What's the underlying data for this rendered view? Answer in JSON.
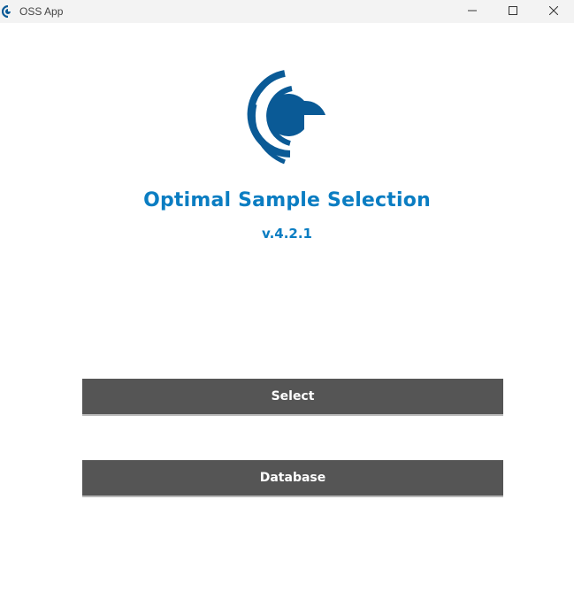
{
  "window": {
    "title": "OSS App",
    "controls": [
      "minimize-icon",
      "maximize-icon",
      "close-icon"
    ]
  },
  "app": {
    "name": "Optimal Sample Selection",
    "version": "v.4.2.1",
    "logo_icon": "oss-logo-icon",
    "brand_color": "#0a7dc2",
    "logo_color": "#0a5a96"
  },
  "actions": {
    "select_label": "Select",
    "database_label": "Database",
    "button_color": "#555555"
  }
}
